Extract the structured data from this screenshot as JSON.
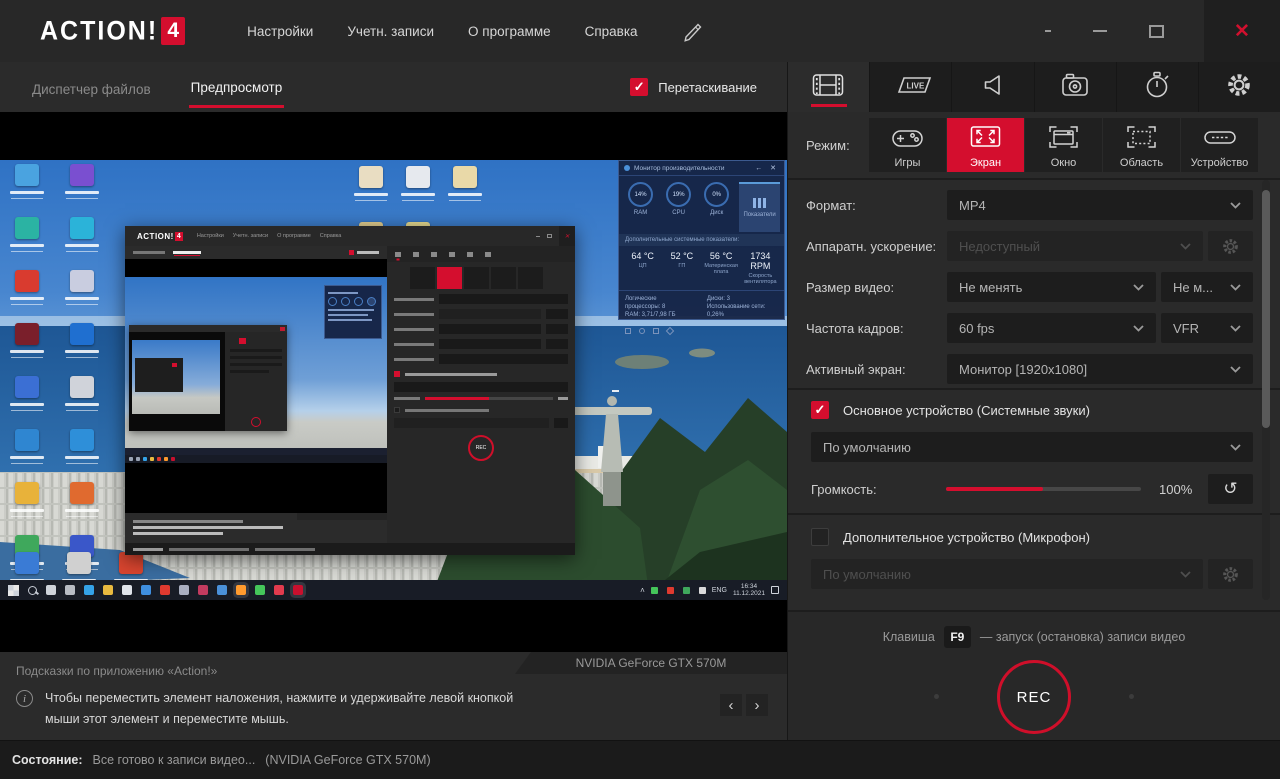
{
  "titlebar": {
    "logo_text": "ACTION!",
    "logo_badge": "4",
    "menu": [
      "Настройки",
      "Учетн. записи",
      "О программе",
      "Справка"
    ]
  },
  "left_panel": {
    "tab_files": "Диспетчер файлов",
    "tab_preview": "Предпросмотр",
    "drag_label": "Перетаскивание",
    "gpu_badge": "NVIDIA GeForce GTX 570M",
    "tips_header": "Подсказки по приложению «Action!»",
    "tip_line1": "Чтобы переместить элемент наложения, нажмите и удерживайте левой кнопкой",
    "tip_line2": "мыши этот элемент и переместите мышь."
  },
  "statusbar": {
    "label": "Состояние:",
    "text": "Все готово к записи видео...",
    "gpu": "(NVIDIA GeForce GTX 570M)"
  },
  "right_panel": {
    "mode_label": "Режим:",
    "modes": [
      {
        "label": "Игры"
      },
      {
        "label": "Экран"
      },
      {
        "label": "Окно"
      },
      {
        "label": "Область"
      },
      {
        "label": "Устройство"
      }
    ],
    "format_label": "Формат:",
    "format_value": "MP4",
    "hwaccel_label": "Аппаратн. ускорение:",
    "hwaccel_value": "Недоступный",
    "size_label": "Размер видео:",
    "size_value": "Не менять",
    "size_extra": "Не м...",
    "fps_label": "Частота кадров:",
    "fps_value": "60 fps",
    "fps_extra": "VFR",
    "screen_label": "Активный экран:",
    "screen_value": "Монитор [1920x1080]",
    "audio_primary_label": "Основное устройство (Системные звуки)",
    "audio_primary_value": "По умолчанию",
    "volume_label": "Громкость:",
    "volume_value": "100%",
    "mic_label": "Дополнительное устройство (Микрофон)",
    "mic_value": "По умолчанию",
    "hotkey_prefix": "Клавиша",
    "hotkey_key": "F9",
    "hotkey_suffix": "— запуск (остановка) записи видео",
    "rec_label": "REC"
  },
  "preview": {
    "widget": {
      "title": "Монитор производительности",
      "rings": [
        {
          "value": "14%",
          "label": "RAM"
        },
        {
          "value": "19%",
          "label": "CPU"
        },
        {
          "value": "0%",
          "label": "Диск"
        }
      ],
      "tab_label": "Показатели",
      "subtitle": "Дополнительные системные показатели:",
      "stats": [
        {
          "value": "64 °C",
          "label": "ЦП"
        },
        {
          "value": "52 °C",
          "label": "ГП"
        },
        {
          "value": "56 °C",
          "label": "Материнская плата"
        },
        {
          "value": "1734 RPM",
          "label": "Скорость вентилятора"
        }
      ],
      "footer_left1": "Логические процессоры: 8",
      "footer_left2": "RAM: 3,71/7,98 ГБ",
      "footer_right1": "Диски: 3",
      "footer_right2": "Использование сети: 0,26%"
    },
    "taskbar": {
      "time": "16:34",
      "date": "11.12.2021",
      "lang": "ENG"
    },
    "desktop_icons_left": [
      "#4aa3e0",
      "#2bb3a3",
      "#d93b2f",
      "#7a1f2b",
      "#3b6fd4",
      "#2f86d1",
      "#e8b23a",
      "#3fa85c",
      "#7a4fd0",
      "#2bb3d9",
      "#c9cde0",
      "#1f6fd0",
      "#d0d3da",
      "#2e8fd9",
      "#e06a2f",
      "#3a57c9"
    ],
    "desktop_icons_mid": [
      "#e9ddc2",
      "#e6e9ee",
      "#e9d9a8",
      "#e3cf8f",
      "#e6d98f"
    ],
    "desktop_icons_bottom": [
      "#3a7bd5",
      "#d0d0d0",
      "#d9452f"
    ],
    "taskbar_icons": [
      "#cfd3da",
      "#b8bcc4",
      "#35a3e8",
      "#e8b93f",
      "#dfe3ea",
      "#3f8fe0",
      "#e03a2f",
      "#a9aec0",
      "#c23b5f",
      "#4a90d9",
      "#ff9a2e",
      "#45c55a",
      "#e23b4e",
      "#c8102e"
    ],
    "tray_icons": [
      "#45c55a",
      "#e03a2f",
      "#3fa85c",
      "#d9d9d9"
    ]
  },
  "colors": {
    "accent": "#d40e2e",
    "close_red": "#d1102e",
    "widget_blue": "#4a90d9"
  }
}
